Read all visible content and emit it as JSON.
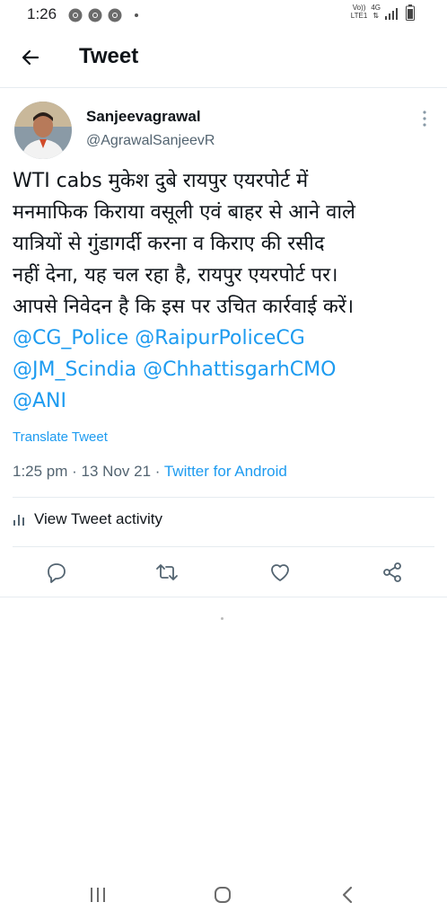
{
  "status_bar": {
    "time": "1:26",
    "network_top": "Vo))",
    "network_bottom": "LTE1",
    "network_type": "4G",
    "app_icons": [
      "chrome-icon",
      "chrome-icon",
      "chrome-icon"
    ]
  },
  "header": {
    "title": "Tweet",
    "back_icon": "arrow-left-icon"
  },
  "tweet": {
    "author_name": "Sanjeevagrawal",
    "author_handle": "@AgrawalSanjeevR",
    "text_lines": [
      "WTI cabs मुकेश दुबे रायपुर एयरपोर्ट  में",
      "मनमाफिक किराया वसूली एवं बाहर से आने वाले",
      "यात्रियों से गुंडागर्दी करना व किराए की रसीद",
      "नहीं देना, यह चल रहा है, रायपुर एयरपोर्ट पर।",
      "आपसे निवेदन है कि इस पर उचित कार्रवाई करें।"
    ],
    "mention_lines": [
      "@CG_Police @RaipurPoliceCG",
      "@JM_Scindia @ChhattisgarhCMO",
      "@ANI"
    ],
    "translate_label": "Translate Tweet",
    "time": "1:25 pm",
    "separator": " · ",
    "date": "13 Nov 21",
    "source": "Twitter for Android",
    "activity_label": "View Tweet activity"
  },
  "actions": [
    "reply-icon",
    "retweet-icon",
    "like-icon",
    "share-icon"
  ],
  "colors": {
    "accent": "#1d9bf0",
    "text": "#0f1419",
    "secondary": "#536471",
    "divider": "#e6ecf0"
  },
  "nav": [
    "recent-apps-icon",
    "home-icon",
    "back-icon"
  ]
}
